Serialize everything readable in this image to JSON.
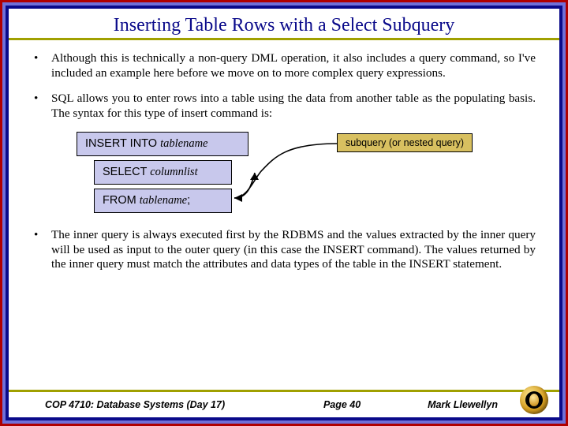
{
  "title": "Inserting Table Rows with a Select Subquery",
  "bullets": {
    "b1": "Although this is technically a non-query DML operation, it also includes a query command, so I've included an example here before we move on to more complex query expressions.",
    "b2": "SQL allows you to enter rows into a table using the data from another table as the populating basis.  The syntax for this type of insert command is:",
    "b3": "The inner query is always executed first by the RDBMS and the values extracted by the inner query will be used as input to the outer query (in this case the INSERT command).  The values returned by the inner query must match the attributes and data types of the table in the INSERT statement."
  },
  "sql": {
    "insert_kw": "INSERT INTO ",
    "insert_arg": "tablename",
    "select_kw": "SELECT ",
    "select_arg": "columnlist",
    "from_kw": "FROM  ",
    "from_arg": "tablename",
    "from_semi": ";"
  },
  "callout": "subquery (or nested query)",
  "footer": {
    "course": "COP 4710: Database Systems  (Day 17)",
    "page": "Page 40",
    "author": "Mark Llewellyn"
  }
}
